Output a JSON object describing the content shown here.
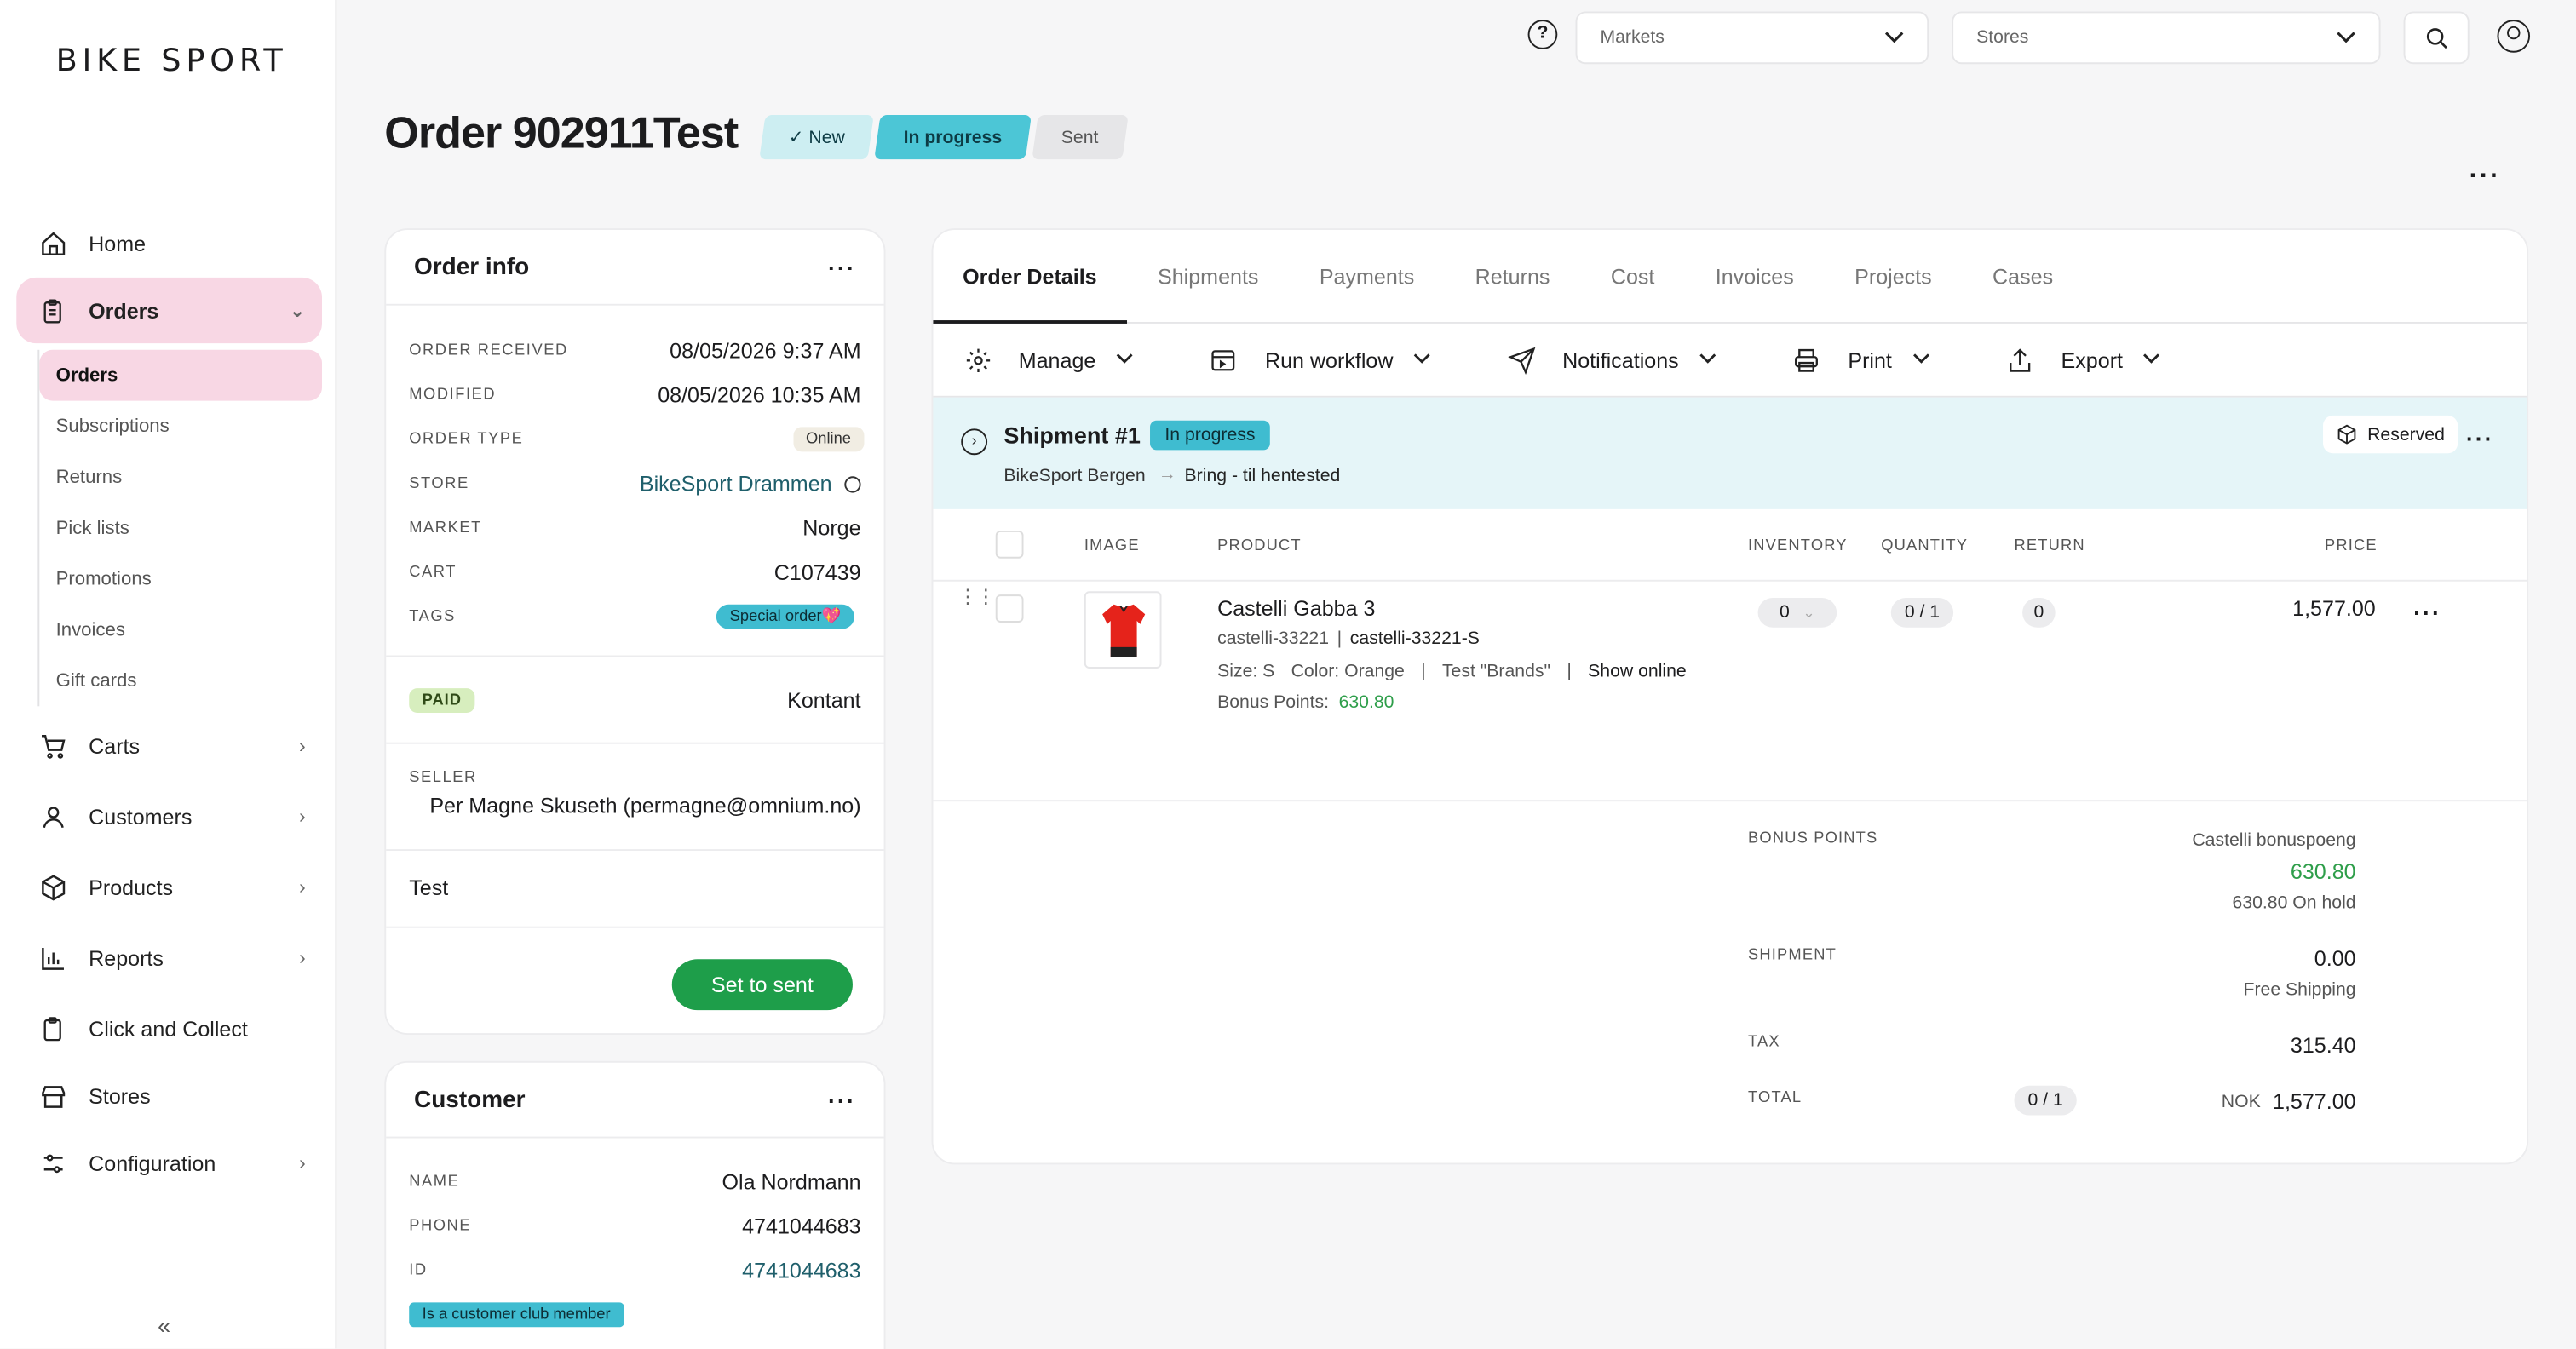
{
  "brand": "BIKE SPORT",
  "nav": {
    "home": "Home",
    "orders": "Orders",
    "orders_sub": [
      "Orders",
      "Subscriptions",
      "Returns",
      "Pick lists",
      "Promotions",
      "Invoices",
      "Gift cards"
    ],
    "carts": "Carts",
    "customers": "Customers",
    "products": "Products",
    "reports": "Reports",
    "click_collect": "Click and Collect",
    "stores": "Stores",
    "configuration": "Configuration",
    "collapse": "«"
  },
  "topbar": {
    "markets_placeholder": "Markets",
    "stores_placeholder": "Stores"
  },
  "order": {
    "title": "Order 902911Test",
    "steps": [
      "✓ New",
      "In progress",
      "Sent"
    ]
  },
  "order_info": {
    "heading": "Order info",
    "rows": [
      {
        "label": "ORDER RECEIVED",
        "value": "08/05/2026 9:37 AM"
      },
      {
        "label": "MODIFIED",
        "value": "08/05/2026 10:35 AM"
      },
      {
        "label": "ORDER TYPE",
        "value": "Online"
      },
      {
        "label": "STORE",
        "value": "BikeSport Drammen"
      },
      {
        "label": "MARKET",
        "value": "Norge"
      },
      {
        "label": "CART",
        "value": "C107439"
      },
      {
        "label": "TAGS",
        "value": "Special order💖"
      }
    ],
    "payment_status": "PAID",
    "payment_method": "Kontant",
    "seller_label": "SELLER",
    "seller_value": "Per Magne Skuseth (permagne@omnium.no)",
    "note": "Test",
    "set_to_sent": "Set to sent"
  },
  "customer": {
    "heading": "Customer",
    "rows": [
      {
        "label": "NAME",
        "value": "Ola Nordmann"
      },
      {
        "label": "PHONE",
        "value": "4741044683"
      },
      {
        "label": "ID",
        "value": "4741044683"
      }
    ],
    "badge": "Is a customer club member"
  },
  "tabs": [
    "Order Details",
    "Shipments",
    "Payments",
    "Returns",
    "Cost",
    "Invoices",
    "Projects",
    "Cases"
  ],
  "toolbar": [
    "Manage",
    "Run workflow",
    "Notifications",
    "Print",
    "Export"
  ],
  "shipment": {
    "title": "Shipment #1",
    "status": "In progress",
    "from": "BikeSport Bergen",
    "arrow": "→",
    "to": "Bring - til hentested",
    "reserved": "Reserved"
  },
  "table": {
    "headers": [
      "IMAGE",
      "PRODUCT",
      "INVENTORY",
      "QUANTITY",
      "RETURN",
      "PRICE"
    ],
    "row": {
      "name": "Castelli Gabba 3",
      "sku1": "castelli-33221",
      "sep": "|",
      "sku2": "castelli-33221-S",
      "size": "Size: S",
      "color": "Color: Orange",
      "brand": "Test \"Brands\"",
      "show_online": "Show online",
      "bonus_label": "Bonus Points:",
      "bonus_value": "630.80",
      "inventory": "0",
      "quantity": "0 / 1",
      "return": "0",
      "price": "1,577.00"
    }
  },
  "summary": {
    "bonus_label": "BONUS POINTS",
    "bonus_name": "Castelli bonuspoeng",
    "bonus_value": "630.80",
    "bonus_hold": "630.80  On hold",
    "shipment_label": "SHIPMENT",
    "shipment_value": "0.00",
    "shipment_note": "Free Shipping",
    "tax_label": "TAX",
    "tax_value": "315.40",
    "total_label": "TOTAL",
    "total_qty": "0 / 1",
    "currency": "NOK",
    "total_value": "1,577.00"
  },
  "colors": {
    "accent_pink": "#f8d7e4",
    "accent_teal": "#4cc6d6",
    "green": "#1e9e4a",
    "link": "#1f5f6b"
  }
}
